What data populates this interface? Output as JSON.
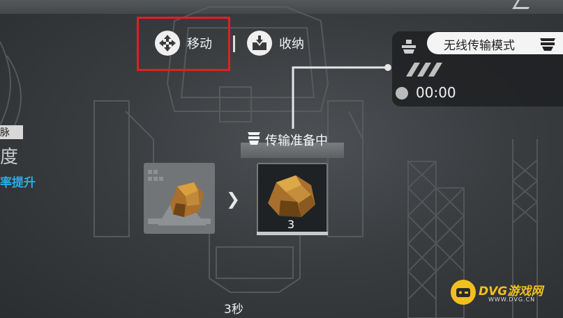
{
  "actions": {
    "move_label": "移动",
    "stow_label": "收纳"
  },
  "transmission_panel": {
    "mode_label": "无线传输模式",
    "timer": "00:00"
  },
  "transfer": {
    "status_label": "传输准备中",
    "target_count": "3"
  },
  "left_partial": {
    "tag_text": "脉",
    "big_text": "度",
    "link_text": "率提升"
  },
  "bottom": {
    "duration": "3秒"
  },
  "watermark": {
    "title": "DVG游戏网",
    "subtitle": "WWW.DVG.CN"
  },
  "colors": {
    "highlight": "#e02020",
    "link": "#27aee8",
    "watermark": "#f2c01e"
  },
  "icons": {
    "move": "move-arrows-icon",
    "stow": "stow-box-icon",
    "mode": "wireless-transfer-icon",
    "status": "transfer-device-icon",
    "arrow": "chevron-right-icon"
  }
}
